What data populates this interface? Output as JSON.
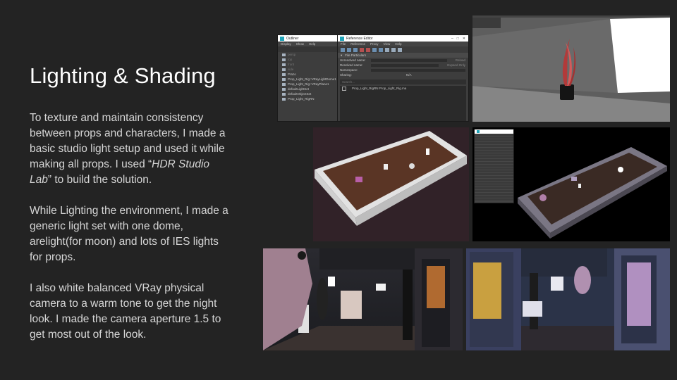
{
  "slide": {
    "title": "Lighting & Shading",
    "paragraph1": {
      "pre": "To texture and maintain consistency between props and characters, I made a basic studio light setup and used it while making all props. I used “",
      "emphasis": "HDR Studio Lab",
      "post": "” to build the solution."
    },
    "paragraph2": "While Lighting the environment,  I made a generic light set with one dome, arelight(for moon) and lots of IES lights for props.",
    "paragraph3": "I also white balanced VRay physical camera to a warm tone to get the night look. I made the camera aperture 1.5 to get most out of  the look."
  },
  "outliner": {
    "title": "Outliner",
    "menu": [
      "Display",
      "Show",
      "Help"
    ],
    "items": [
      "persp",
      "top",
      "front",
      "side",
      "Prazo",
      "Prop_Light_Rig::VRayLightDome1",
      "Prop_Light_Rig::VRayPlane1",
      "defaultLightSet",
      "defaultObjectSet",
      "Prop_Light_RigRN"
    ]
  },
  "reference_editor": {
    "title": "Reference Editor",
    "menu": [
      "File",
      "Reference",
      "Proxy",
      "View",
      "Help"
    ],
    "section": "File Particulars",
    "fields": [
      "Unresolved name:",
      "Resolved name:",
      "Namespace:",
      "Sharing:"
    ],
    "reload_label": "Reload",
    "expand_label": "Expand Only",
    "na_label": "N/A",
    "search_placeholder": "Search...",
    "reference_row": "Prop_Light_RigRN  Prop_Light_Rig.ma"
  },
  "colors": {
    "background": "#232323",
    "title": "#ffffff",
    "body": "#d6d6d6",
    "maya_accent": "#1fa3b8"
  }
}
